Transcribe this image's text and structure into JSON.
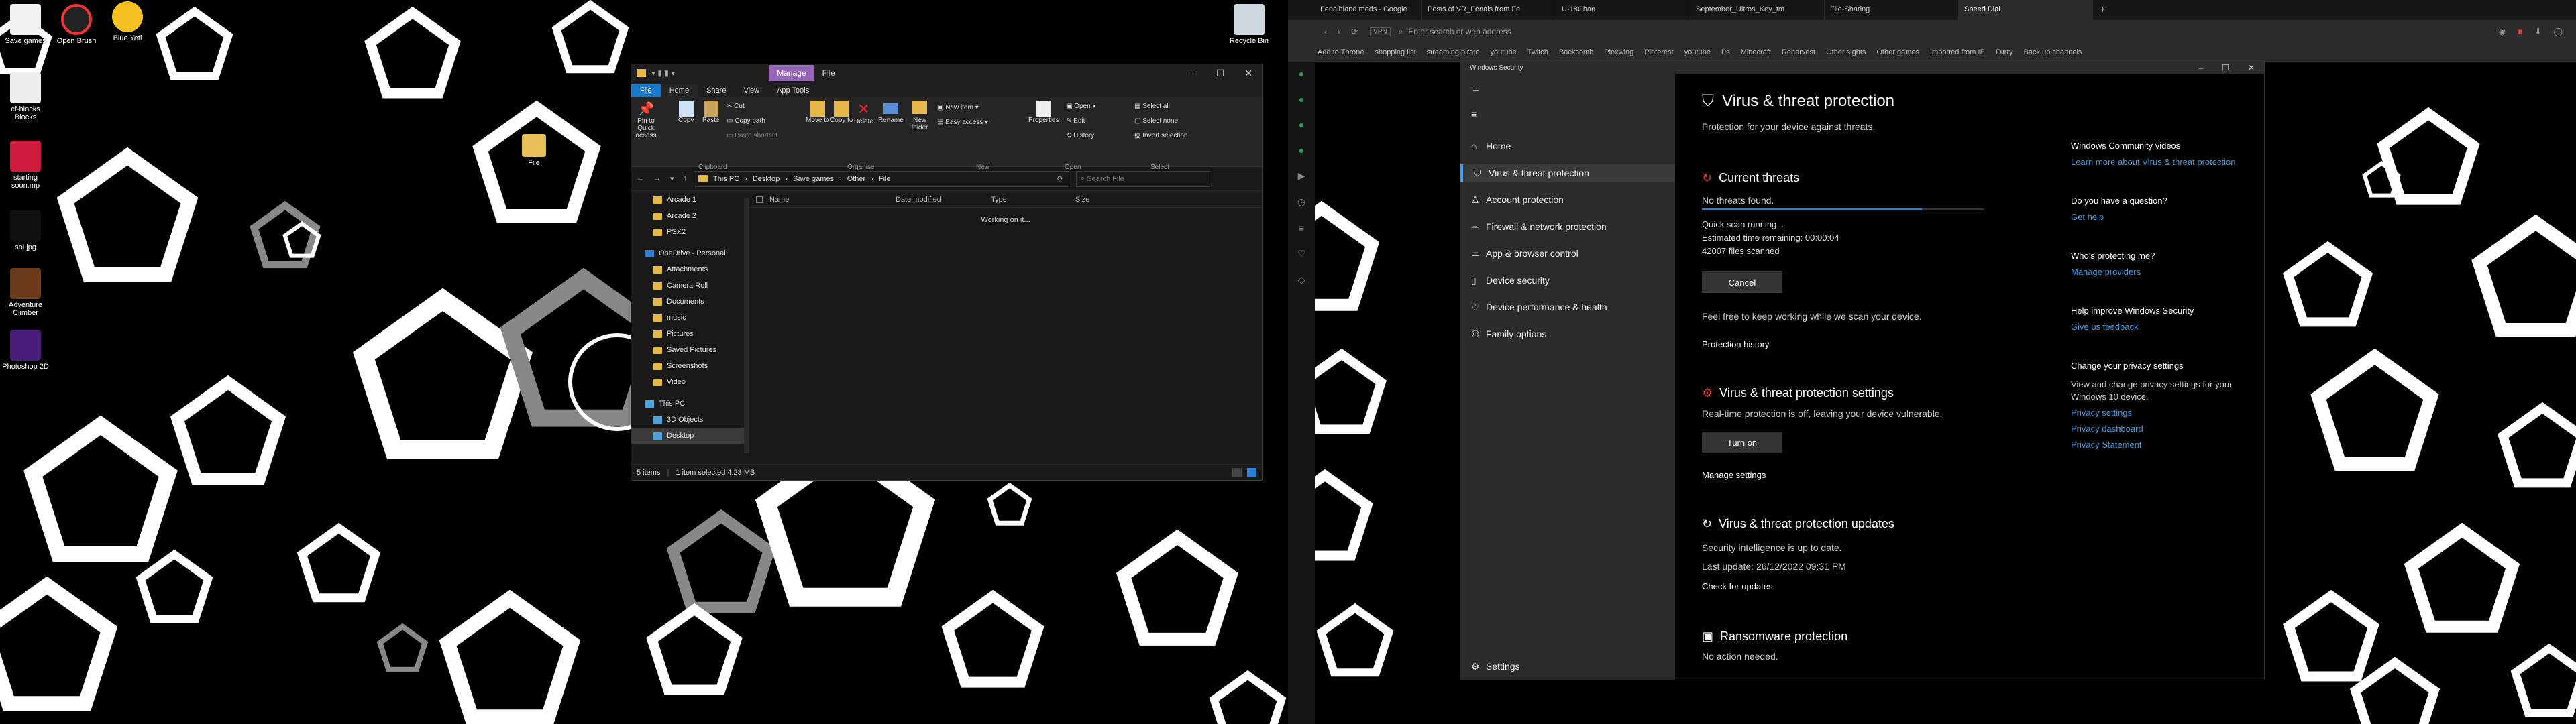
{
  "desktop": {
    "icons": [
      {
        "label": "Save games"
      },
      {
        "label": "Open Brush"
      },
      {
        "label": "Blue Yeti"
      },
      {
        "label": "Recycle Bin"
      },
      {
        "label": "cf-blocks\nBlocks"
      },
      {
        "label": "File"
      },
      {
        "label": "starting\nsoon.mp"
      },
      {
        "label": "sol.jpg"
      },
      {
        "label": "Adventure\nClimber"
      },
      {
        "label": "Photoshop 2D"
      }
    ]
  },
  "explorer": {
    "title": "File",
    "manage_tab": "Manage",
    "tabs": [
      "File",
      "Home",
      "Share",
      "View",
      "App Tools"
    ],
    "ribbon": {
      "clipboard": "Clipboard",
      "organise": "Organise",
      "new": "New",
      "open": "Open",
      "select": "Select",
      "pin": "Pin to Quick access",
      "copy": "Copy",
      "paste": "Paste",
      "cut": "Cut",
      "copy_path": "Copy path",
      "paste_shortcut": "Paste shortcut",
      "move_to": "Move to",
      "copy_to": "Copy to",
      "delete": "Delete",
      "rename": "Rename",
      "new_folder": "New folder",
      "new_item": "New item",
      "easy_access": "Easy access",
      "properties": "Properties",
      "open_btn": "Open",
      "edit": "Edit",
      "history": "History",
      "select_all": "Select all",
      "select_none": "Select none",
      "invert_selection": "Invert selection"
    },
    "path": [
      "This PC",
      "Desktop",
      "Save games",
      "Other",
      "File"
    ],
    "search_placeholder": "Search File",
    "nav": [
      "Arcade 1",
      "Arcade 2",
      "PSX2",
      "OneDrive - Personal",
      "Attachments",
      "Camera Roll",
      "Documents",
      "music",
      "Pictures",
      "Saved Pictures",
      "Screenshots",
      "Video",
      "This PC",
      "3D Objects",
      "Desktop"
    ],
    "columns": [
      "Name",
      "Date modified",
      "Type",
      "Size"
    ],
    "working": "Working on it...",
    "status": [
      "5 items",
      "1 item selected  4.23 MB"
    ]
  },
  "browser": {
    "tabs": [
      "Fenalbland mods - Google",
      "Posts of VR_Fenals from Fe",
      "U-18Chan",
      "September_Ultros_Key_tm",
      "File-Sharing",
      "Speed Dial"
    ],
    "address_placeholder": "Enter search or web address",
    "bookmarks": [
      "Add to Throne",
      "shopping list",
      "streaming pirate",
      "youtube",
      "Twitch",
      "Backcomb",
      "Plexwing",
      "Pinterest",
      "youtube",
      "Ps",
      "Minecraft",
      "Reharvest",
      "Other sights",
      "Other games",
      "Imported from IE",
      "Furry",
      "Back up channels"
    ]
  },
  "security": {
    "window_title": "Windows Security",
    "nav": [
      "Home",
      "Virus & threat protection",
      "Account protection",
      "Firewall & network protection",
      "App & browser control",
      "Device security",
      "Device performance & health",
      "Family options",
      "Settings"
    ],
    "heading": "Virus & threat protection",
    "subheading": "Protection for your device against threats.",
    "current_threats": "Current threats",
    "no_threats": "No threats found.",
    "scan_progress": 0.78,
    "scan_line1": "Quick scan running...",
    "scan_line2": "Estimated time remaining: 00:00:04",
    "scan_line3": "42007 files scanned",
    "cancel": "Cancel",
    "feel_free": "Feel free to keep working while we scan your device.",
    "protection_history": "Protection history",
    "settings_heading": "Virus & threat protection settings",
    "settings_text": "Real-time protection is off, leaving your device vulnerable.",
    "turn_on": "Turn on",
    "manage_settings": "Manage settings",
    "updates_heading": "Virus & threat protection updates",
    "updates_line1": "Security intelligence is up to date.",
    "updates_line2": "Last update: 26/12/2022 09:31 PM",
    "check_updates": "Check for updates",
    "ransom_heading": "Ransomware protection",
    "ransom_text": "No action needed.",
    "side": {
      "community": "Windows Community videos",
      "community_link": "Learn more about Virus & threat protection",
      "question": "Do you have a question?",
      "get_help": "Get help",
      "who": "Who's protecting me?",
      "manage_providers": "Manage providers",
      "improve": "Help improve Windows Security",
      "feedback": "Give us feedback",
      "privacy": "Change your privacy settings",
      "privacy_text": "View and change privacy settings for your Windows 10 device.",
      "privacy_settings": "Privacy settings",
      "privacy_dashboard": "Privacy dashboard",
      "privacy_statement": "Privacy Statement"
    }
  }
}
